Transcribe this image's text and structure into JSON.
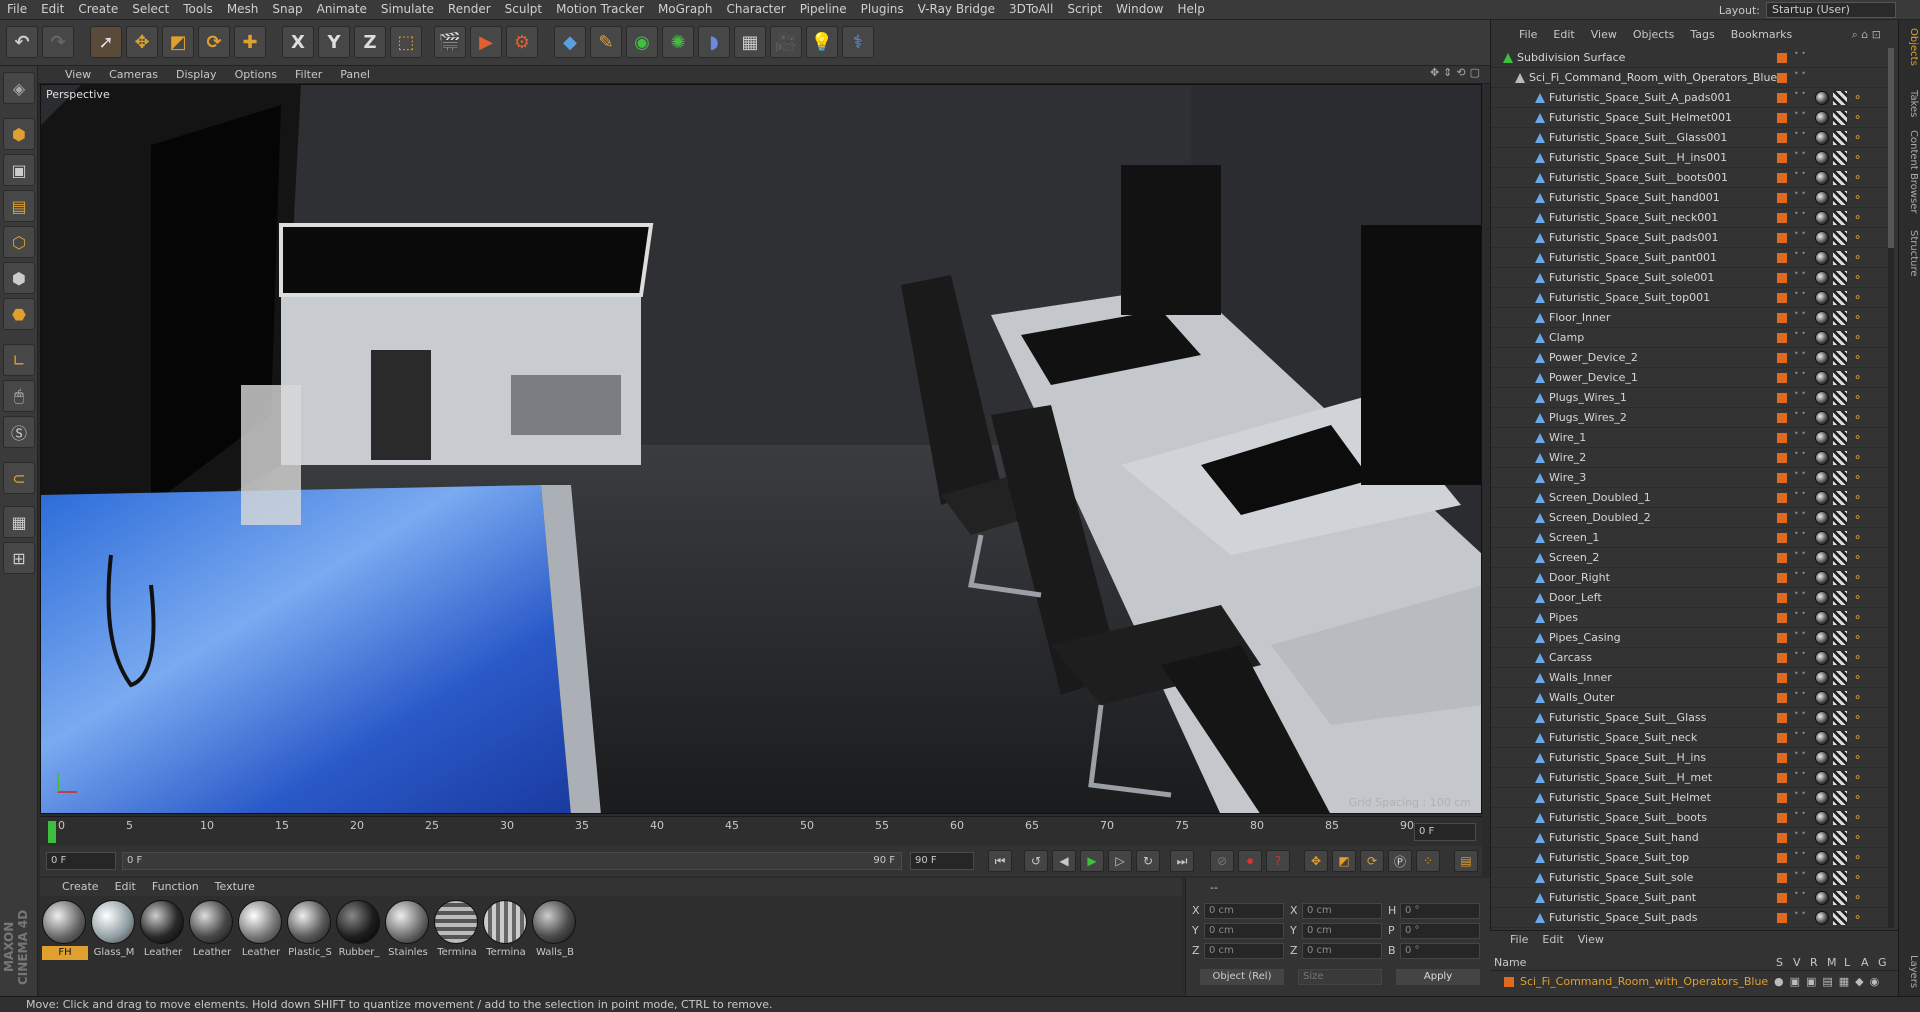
{
  "menubar": {
    "items": [
      "File",
      "Edit",
      "Create",
      "Select",
      "Tools",
      "Mesh",
      "Snap",
      "Animate",
      "Simulate",
      "Render",
      "Sculpt",
      "Motion Tracker",
      "MoGraph",
      "Character",
      "Pipeline",
      "Plugins",
      "V-Ray Bridge",
      "3DToAll",
      "Script",
      "Window",
      "Help"
    ],
    "layout_label": "Layout:",
    "layout_value": "Startup (User)"
  },
  "toolbar": {
    "axis_x": "X",
    "axis_y": "Y",
    "axis_z": "Z"
  },
  "viewport": {
    "menu": [
      "View",
      "Cameras",
      "Display",
      "Options",
      "Filter",
      "Panel"
    ],
    "label": "Perspective",
    "grid_spacing": "Grid Spacing : 100 cm"
  },
  "timeline": {
    "ticks": [
      "0",
      "5",
      "10",
      "15",
      "20",
      "25",
      "30",
      "35",
      "40",
      "45",
      "50",
      "55",
      "60",
      "65",
      "70",
      "75",
      "80",
      "85",
      "90"
    ],
    "end_frame_field": "0 F",
    "current_frame": "0 F",
    "range_start": "0 F",
    "range_end_inner": "90 F",
    "range_end": "90 F"
  },
  "materials": {
    "menu": [
      "Create",
      "Edit",
      "Function",
      "Texture"
    ],
    "items": [
      {
        "name": "FH",
        "color": "#606060"
      },
      {
        "name": "Glass_M",
        "color": "#8c9aa0"
      },
      {
        "name": "Leather",
        "color": "#2a2a2a"
      },
      {
        "name": "Leather",
        "color": "#484848"
      },
      {
        "name": "Leather",
        "color": "#7a7a7a"
      },
      {
        "name": "Plastic_S",
        "color": "#5a5a5a"
      },
      {
        "name": "Rubber_",
        "color": "#1e1e1e"
      },
      {
        "name": "Stainles",
        "color": "#6e6e6e"
      },
      {
        "name": "Termina",
        "color": "#909090"
      },
      {
        "name": "Termina",
        "color": "#a0a0a0"
      },
      {
        "name": "Walls_B",
        "color": "#4a4a4a"
      }
    ]
  },
  "coords": {
    "header": "--",
    "rows": [
      {
        "a": "X",
        "av": "0 cm",
        "b": "X",
        "bv": "0 cm",
        "c": "H",
        "cv": "0 °"
      },
      {
        "a": "Y",
        "av": "0 cm",
        "b": "Y",
        "bv": "0 cm",
        "c": "P",
        "cv": "0 °"
      },
      {
        "a": "Z",
        "av": "0 cm",
        "b": "Z",
        "bv": "0 cm",
        "c": "B",
        "cv": "0 °"
      }
    ],
    "mode": "Object (Rel)",
    "size": "Size",
    "apply": "Apply"
  },
  "object_manager": {
    "menu": [
      "File",
      "Edit",
      "View",
      "Objects",
      "Tags",
      "Bookmarks"
    ],
    "root": "Subdivision Surface",
    "group": "Sci_Fi_Command_Room_with_Operators_Blue",
    "objects": [
      "Futuristic_Space_Suit_A_pads001",
      "Futuristic_Space_Suit_Helmet001",
      "Futuristic_Space_Suit__Glass001",
      "Futuristic_Space_Suit__H_ins001",
      "Futuristic_Space_Suit__boots001",
      "Futuristic_Space_Suit_hand001",
      "Futuristic_Space_Suit_neck001",
      "Futuristic_Space_Suit_pads001",
      "Futuristic_Space_Suit_pant001",
      "Futuristic_Space_Suit_sole001",
      "Futuristic_Space_Suit_top001",
      "Floor_Inner",
      "Clamp",
      "Power_Device_2",
      "Power_Device_1",
      "Plugs_Wires_1",
      "Plugs_Wires_2",
      "Wire_1",
      "Wire_2",
      "Wire_3",
      "Screen_Doubled_1",
      "Screen_Doubled_2",
      "Screen_1",
      "Screen_2",
      "Door_Right",
      "Door_Left",
      "Pipes",
      "Pipes_Casing",
      "Carcass",
      "Walls_Inner",
      "Walls_Outer",
      "Futuristic_Space_Suit__Glass",
      "Futuristic_Space_Suit_neck",
      "Futuristic_Space_Suit__H_ins",
      "Futuristic_Space_Suit__H_met",
      "Futuristic_Space_Suit_Helmet",
      "Futuristic_Space_Suit__boots",
      "Futuristic_Space_Suit_hand",
      "Futuristic_Space_Suit_top",
      "Futuristic_Space_Suit_sole",
      "Futuristic_Space_Suit_pant",
      "Futuristic_Space_Suit_pads"
    ]
  },
  "attributes": {
    "menu": [
      "File",
      "Edit",
      "View"
    ],
    "col_name": "Name",
    "cols": [
      "S",
      "V",
      "R",
      "M",
      "L",
      "A",
      "G"
    ],
    "row": "Sci_Fi_Command_Room_with_Operators_Blue"
  },
  "right_tabs": [
    "Objects",
    "Takes",
    "Content Browser",
    "Structure",
    "Layers"
  ],
  "status": "Move: Click and drag to move elements. Hold down SHIFT to quantize movement / add to the selection in point mode, CTRL to remove.",
  "brand": "MAXON CINEMA 4D"
}
